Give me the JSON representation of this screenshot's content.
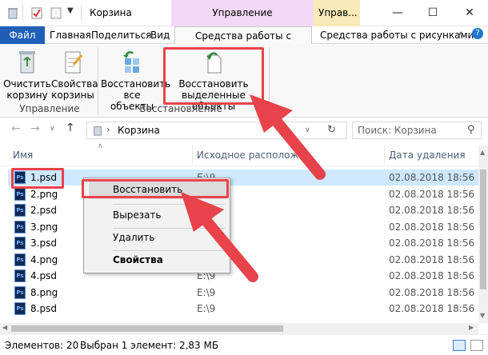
{
  "title": "Корзина",
  "contextual_tabs": {
    "manage_1": "Управление",
    "manage_2": "Управ..."
  },
  "ribbon_tabs": {
    "file": "Файл",
    "home": "Главная",
    "share": "Поделиться",
    "view": "Вид",
    "recycle_tools": "Средства работы с корзиной",
    "picture_tools": "Средства работы с рисунками"
  },
  "ribbon": {
    "empty_bin": [
      "Очистить",
      "корзину"
    ],
    "bin_props": [
      "Свойства",
      "корзины"
    ],
    "group_manage": "Управление",
    "restore_all": [
      "Восстановить",
      "все объекты"
    ],
    "restore_selected": [
      "Восстановить",
      "выделенные объекты"
    ],
    "group_restore": "Восстановление"
  },
  "address": {
    "path": "Корзина",
    "search_placeholder": "Поиск: Корзина"
  },
  "columns": {
    "name": "Имя",
    "original_location": "Исходное расположе...",
    "date_deleted": "Дата удаления"
  },
  "files": [
    {
      "name": "1.psd",
      "location": "E:\\9",
      "date": "02.08.2018 18:56"
    },
    {
      "name": "2.png",
      "location": "",
      "date": "02.08.2018 18:56"
    },
    {
      "name": "2.psd",
      "location": "",
      "date": "02.08.2018 18:56"
    },
    {
      "name": "3.png",
      "location": "",
      "date": "02.08.2018 18:56"
    },
    {
      "name": "3.psd",
      "location": "",
      "date": "02.08.2018 18:56"
    },
    {
      "name": "4.png",
      "location": "",
      "date": "02.08.2018 18:56"
    },
    {
      "name": "4.psd",
      "location": "E:\\9",
      "date": "02.08.2018 18:56"
    },
    {
      "name": "8.png",
      "location": "E:\\9",
      "date": "02.08.2018 18:56"
    },
    {
      "name": "8.psd",
      "location": "E:\\9",
      "date": "02.08.2018 18:56"
    }
  ],
  "context_menu": {
    "restore": "Восстановить",
    "cut": "Вырезать",
    "delete": "Удалить",
    "properties": "Свойства"
  },
  "status": {
    "items": "Элементов: 20",
    "selected": "Выбран 1 элемент: 2,83 МБ"
  },
  "colors": {
    "accent": "#1f5fb8",
    "highlight": "#e8434a",
    "selection": "#cde8ff",
    "contextual_pink": "#f3d9f7",
    "contextual_yellow": "#fbe9b7"
  }
}
